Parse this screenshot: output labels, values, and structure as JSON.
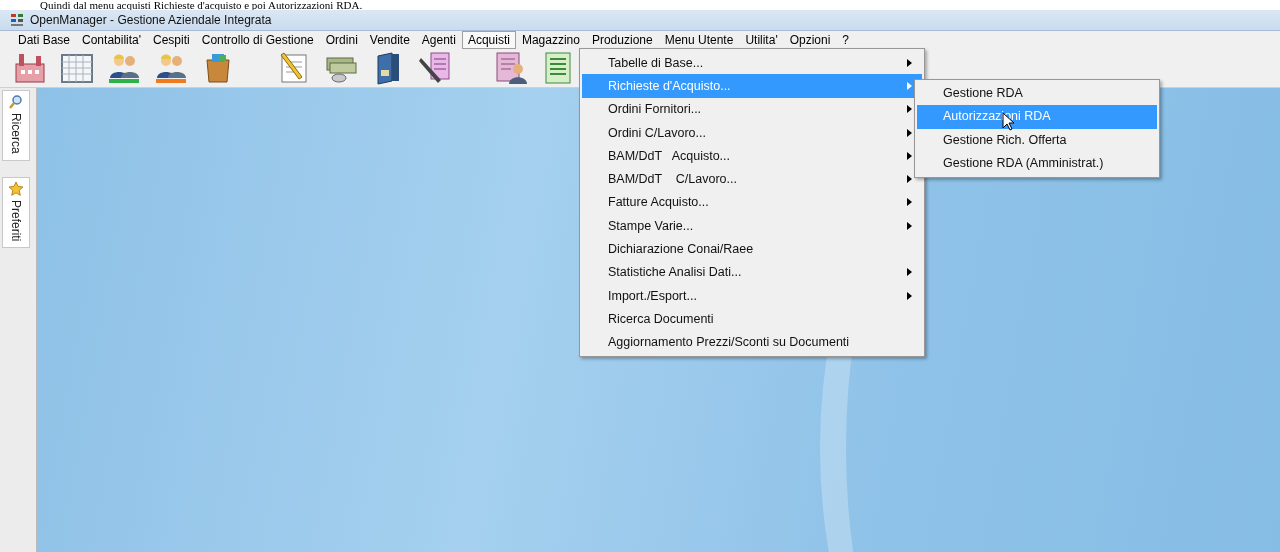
{
  "caption": "Quindi dal menu acquisti Richieste d'acquisto e poi Autorizzazioni RDA.",
  "window": {
    "title": "OpenManager  -  Gestione Aziendale Integrata"
  },
  "menu_bar": [
    {
      "label": "Dati Base",
      "selected": false
    },
    {
      "label": "Contabilita'",
      "selected": false
    },
    {
      "label": "Cespiti",
      "selected": false
    },
    {
      "label": "Controllo di Gestione",
      "selected": false
    },
    {
      "label": "Ordini",
      "selected": false
    },
    {
      "label": "Vendite",
      "selected": false
    },
    {
      "label": "Agenti",
      "selected": false
    },
    {
      "label": "Acquisti",
      "selected": true
    },
    {
      "label": "Magazzino",
      "selected": false
    },
    {
      "label": "Produzione",
      "selected": false
    },
    {
      "label": "Menu Utente",
      "selected": false
    },
    {
      "label": "Utilita'",
      "selected": false
    },
    {
      "label": "Opzioni",
      "selected": false
    },
    {
      "label": "?",
      "selected": false
    }
  ],
  "toolbar": [
    {
      "kind": "factory"
    },
    {
      "kind": "grid"
    },
    {
      "kind": "people-green"
    },
    {
      "kind": "people-orange"
    },
    {
      "kind": "bag"
    },
    {
      "kind": "gap"
    },
    {
      "kind": "notepad"
    },
    {
      "kind": "money"
    },
    {
      "kind": "binder"
    },
    {
      "kind": "pen-doc"
    },
    {
      "kind": "gap"
    },
    {
      "kind": "person-doc"
    },
    {
      "kind": "list-doc"
    }
  ],
  "side_tabs": [
    {
      "label": "Ricerca",
      "kind": "search"
    },
    {
      "label": "Preferiti",
      "kind": "star"
    }
  ],
  "dropdown": [
    {
      "label": "Tabelle di Base...",
      "submenu": true,
      "selected": false
    },
    {
      "label": "Richieste d'Acquisto...",
      "submenu": true,
      "selected": true
    },
    {
      "label": "Ordini Fornitori...",
      "submenu": true,
      "selected": false
    },
    {
      "label": "Ordini C/Lavoro...",
      "submenu": true,
      "selected": false
    },
    {
      "label": "BAM/DdT   Acquisto...",
      "submenu": true,
      "selected": false
    },
    {
      "label": "BAM/DdT    C/Lavoro...",
      "submenu": true,
      "selected": false
    },
    {
      "label": "Fatture Acquisto...",
      "submenu": true,
      "selected": false
    },
    {
      "label": "Stampe Varie...",
      "submenu": true,
      "selected": false
    },
    {
      "label": "Dichiarazione Conai/Raee",
      "submenu": false,
      "selected": false
    },
    {
      "label": "Statistiche Analisi Dati...",
      "submenu": true,
      "selected": false
    },
    {
      "label": "Import./Esport...",
      "submenu": true,
      "selected": false
    },
    {
      "label": "Ricerca Documenti",
      "submenu": false,
      "selected": false
    },
    {
      "label": "Aggiornamento Prezzi/Sconti su Documenti",
      "submenu": false,
      "selected": false
    }
  ],
  "submenu": [
    {
      "label": "Gestione RDA",
      "selected": false
    },
    {
      "label": "Autorizzazioni RDA",
      "selected": true
    },
    {
      "label": "Gestione Rich. Offerta",
      "selected": false
    },
    {
      "label": "Gestione RDA (Amministrat.)",
      "selected": false
    }
  ]
}
